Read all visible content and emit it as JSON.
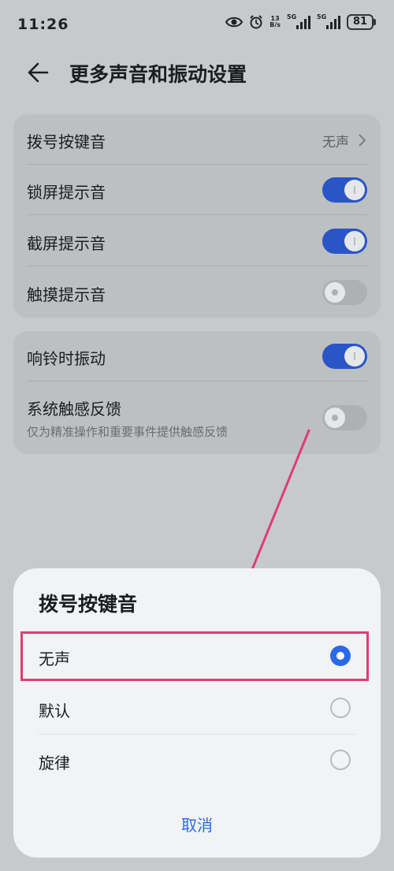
{
  "status_bar": {
    "time": "11:26",
    "net_speed_value": "13",
    "net_speed_unit": "B/s",
    "sim1_label": "5G",
    "sim2_label": "5G",
    "battery": "81"
  },
  "header": {
    "back_icon": "arrow-left-icon",
    "title": "更多声音和振动设置"
  },
  "settings_group1": {
    "items": [
      {
        "label": "拨号按键音",
        "value": "无声"
      },
      {
        "label": "锁屏提示音",
        "toggle": "on"
      },
      {
        "label": "截屏提示音",
        "toggle": "on"
      },
      {
        "label": "触摸提示音",
        "toggle": "off"
      }
    ]
  },
  "settings_group2": {
    "items": [
      {
        "label": "响铃时振动",
        "toggle": "on"
      },
      {
        "label": "系统触感反馈",
        "description": "仅为精准操作和重要事件提供触感反馈",
        "toggle": "off"
      }
    ]
  },
  "dialog": {
    "title": "拨号按键音",
    "options": [
      {
        "label": "无声",
        "selected": true
      },
      {
        "label": "默认",
        "selected": false
      },
      {
        "label": "旋律",
        "selected": false
      }
    ],
    "cancel_label": "取消"
  },
  "colors": {
    "accent": "#2a6ae8",
    "toggle_on": "#2a55c7",
    "annotation": "#df3d72"
  }
}
